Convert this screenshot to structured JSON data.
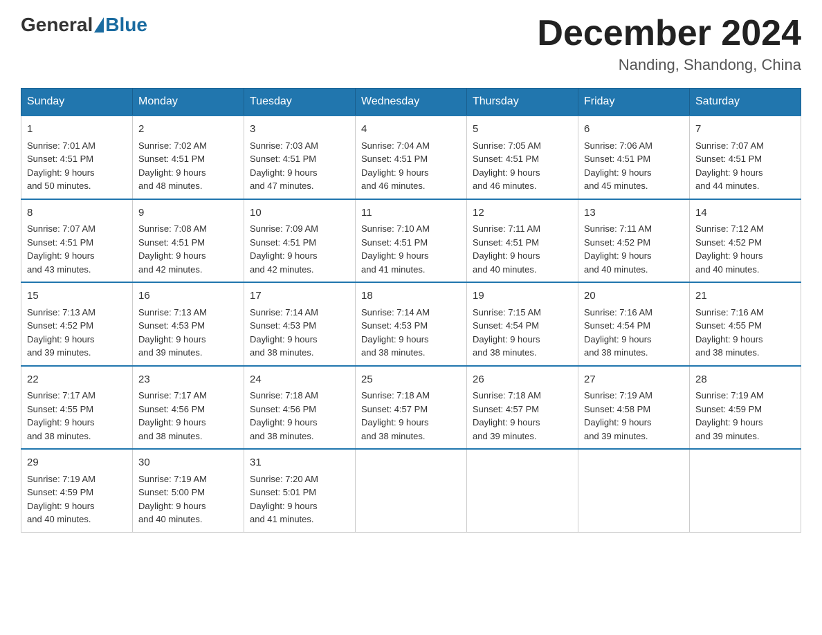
{
  "header": {
    "logo_general": "General",
    "logo_blue": "Blue",
    "month_title": "December 2024",
    "location": "Nanding, Shandong, China"
  },
  "weekdays": [
    "Sunday",
    "Monday",
    "Tuesday",
    "Wednesday",
    "Thursday",
    "Friday",
    "Saturday"
  ],
  "weeks": [
    [
      {
        "day": "1",
        "sunrise": "7:01 AM",
        "sunset": "4:51 PM",
        "daylight": "9 hours and 50 minutes."
      },
      {
        "day": "2",
        "sunrise": "7:02 AM",
        "sunset": "4:51 PM",
        "daylight": "9 hours and 48 minutes."
      },
      {
        "day": "3",
        "sunrise": "7:03 AM",
        "sunset": "4:51 PM",
        "daylight": "9 hours and 47 minutes."
      },
      {
        "day": "4",
        "sunrise": "7:04 AM",
        "sunset": "4:51 PM",
        "daylight": "9 hours and 46 minutes."
      },
      {
        "day": "5",
        "sunrise": "7:05 AM",
        "sunset": "4:51 PM",
        "daylight": "9 hours and 46 minutes."
      },
      {
        "day": "6",
        "sunrise": "7:06 AM",
        "sunset": "4:51 PM",
        "daylight": "9 hours and 45 minutes."
      },
      {
        "day": "7",
        "sunrise": "7:07 AM",
        "sunset": "4:51 PM",
        "daylight": "9 hours and 44 minutes."
      }
    ],
    [
      {
        "day": "8",
        "sunrise": "7:07 AM",
        "sunset": "4:51 PM",
        "daylight": "9 hours and 43 minutes."
      },
      {
        "day": "9",
        "sunrise": "7:08 AM",
        "sunset": "4:51 PM",
        "daylight": "9 hours and 42 minutes."
      },
      {
        "day": "10",
        "sunrise": "7:09 AM",
        "sunset": "4:51 PM",
        "daylight": "9 hours and 42 minutes."
      },
      {
        "day": "11",
        "sunrise": "7:10 AM",
        "sunset": "4:51 PM",
        "daylight": "9 hours and 41 minutes."
      },
      {
        "day": "12",
        "sunrise": "7:11 AM",
        "sunset": "4:51 PM",
        "daylight": "9 hours and 40 minutes."
      },
      {
        "day": "13",
        "sunrise": "7:11 AM",
        "sunset": "4:52 PM",
        "daylight": "9 hours and 40 minutes."
      },
      {
        "day": "14",
        "sunrise": "7:12 AM",
        "sunset": "4:52 PM",
        "daylight": "9 hours and 40 minutes."
      }
    ],
    [
      {
        "day": "15",
        "sunrise": "7:13 AM",
        "sunset": "4:52 PM",
        "daylight": "9 hours and 39 minutes."
      },
      {
        "day": "16",
        "sunrise": "7:13 AM",
        "sunset": "4:53 PM",
        "daylight": "9 hours and 39 minutes."
      },
      {
        "day": "17",
        "sunrise": "7:14 AM",
        "sunset": "4:53 PM",
        "daylight": "9 hours and 38 minutes."
      },
      {
        "day": "18",
        "sunrise": "7:14 AM",
        "sunset": "4:53 PM",
        "daylight": "9 hours and 38 minutes."
      },
      {
        "day": "19",
        "sunrise": "7:15 AM",
        "sunset": "4:54 PM",
        "daylight": "9 hours and 38 minutes."
      },
      {
        "day": "20",
        "sunrise": "7:16 AM",
        "sunset": "4:54 PM",
        "daylight": "9 hours and 38 minutes."
      },
      {
        "day": "21",
        "sunrise": "7:16 AM",
        "sunset": "4:55 PM",
        "daylight": "9 hours and 38 minutes."
      }
    ],
    [
      {
        "day": "22",
        "sunrise": "7:17 AM",
        "sunset": "4:55 PM",
        "daylight": "9 hours and 38 minutes."
      },
      {
        "day": "23",
        "sunrise": "7:17 AM",
        "sunset": "4:56 PM",
        "daylight": "9 hours and 38 minutes."
      },
      {
        "day": "24",
        "sunrise": "7:18 AM",
        "sunset": "4:56 PM",
        "daylight": "9 hours and 38 minutes."
      },
      {
        "day": "25",
        "sunrise": "7:18 AM",
        "sunset": "4:57 PM",
        "daylight": "9 hours and 38 minutes."
      },
      {
        "day": "26",
        "sunrise": "7:18 AM",
        "sunset": "4:57 PM",
        "daylight": "9 hours and 39 minutes."
      },
      {
        "day": "27",
        "sunrise": "7:19 AM",
        "sunset": "4:58 PM",
        "daylight": "9 hours and 39 minutes."
      },
      {
        "day": "28",
        "sunrise": "7:19 AM",
        "sunset": "4:59 PM",
        "daylight": "9 hours and 39 minutes."
      }
    ],
    [
      {
        "day": "29",
        "sunrise": "7:19 AM",
        "sunset": "4:59 PM",
        "daylight": "9 hours and 40 minutes."
      },
      {
        "day": "30",
        "sunrise": "7:19 AM",
        "sunset": "5:00 PM",
        "daylight": "9 hours and 40 minutes."
      },
      {
        "day": "31",
        "sunrise": "7:20 AM",
        "sunset": "5:01 PM",
        "daylight": "9 hours and 41 minutes."
      },
      null,
      null,
      null,
      null
    ]
  ],
  "labels": {
    "sunrise": "Sunrise:",
    "sunset": "Sunset:",
    "daylight": "Daylight:"
  }
}
